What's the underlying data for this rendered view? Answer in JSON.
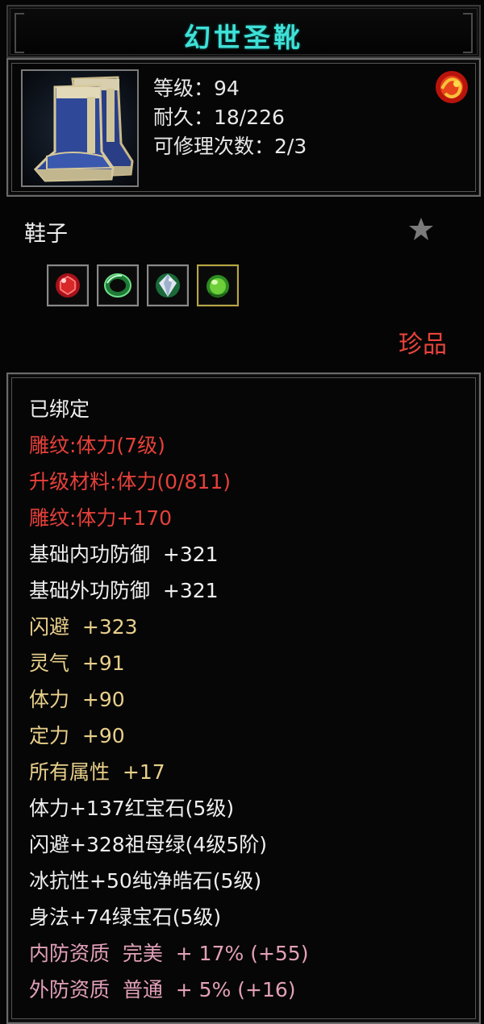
{
  "item": {
    "name": "幻世圣靴",
    "level_line": "等级：94",
    "durability_line": "耐久：18/226",
    "repair_line": "可修理次数：2/3",
    "type": "鞋子",
    "rarity": "珍品",
    "icon": "blue-boots-icon",
    "bag_icon": "fire-orb-icon",
    "star_icon": "star-icon"
  },
  "gems": [
    {
      "name": "red-ruby-gem-icon",
      "color": "#d8282a"
    },
    {
      "name": "green-emerald-gem-icon",
      "color": "#2fa84a"
    },
    {
      "name": "white-diamond-gem-icon",
      "color": "#cfd8e8"
    },
    {
      "name": "green-jade-gem-icon",
      "color": "#6fcf3a"
    }
  ],
  "attributes": [
    {
      "text": "已绑定",
      "color": "white"
    },
    {
      "text": "雕纹:体力(7级)",
      "color": "red"
    },
    {
      "text": "升级材料:体力(0/811)",
      "color": "red"
    },
    {
      "text": "雕纹:体力+170",
      "color": "red"
    },
    {
      "text": "基础内功防御  +321",
      "color": "white"
    },
    {
      "text": "基础外功防御  +321",
      "color": "white"
    },
    {
      "text": "闪避  +323",
      "color": "gold"
    },
    {
      "text": "灵气  +91",
      "color": "gold"
    },
    {
      "text": "体力  +90",
      "color": "gold"
    },
    {
      "text": "定力  +90",
      "color": "gold"
    },
    {
      "text": "所有属性  +17",
      "color": "gold"
    },
    {
      "text": "体力+137红宝石(5级)",
      "color": "white"
    },
    {
      "text": "闪避+328祖母绿(4级5阶)",
      "color": "white"
    },
    {
      "text": "冰抗性+50纯净皓石(5级)",
      "color": "white"
    },
    {
      "text": "身法+74绿宝石(5级)",
      "color": "white"
    },
    {
      "text": "内防资质  完美  + 17% (+55)",
      "color": "pink"
    },
    {
      "text": "外防资质  普通  + 5% (+16)",
      "color": "pink"
    }
  ]
}
